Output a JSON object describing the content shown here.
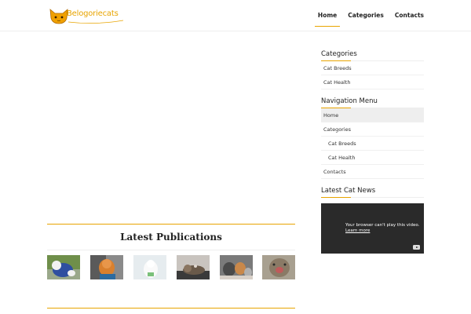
{
  "header": {
    "logo_text": "Belogoriecats",
    "nav": [
      {
        "label": "Home",
        "active": true
      },
      {
        "label": "Categories",
        "active": false
      },
      {
        "label": "Contacts",
        "active": false
      }
    ]
  },
  "publications": {
    "title": "Latest Publications",
    "thumbnails": [
      {
        "icon": "cat-blue-sweater-photo"
      },
      {
        "icon": "orange-kitten-photo"
      },
      {
        "icon": "white-cat-photo"
      },
      {
        "icon": "cat-lying-photo"
      },
      {
        "icon": "cats-group-photo"
      },
      {
        "icon": "cat-yawning-photo"
      }
    ]
  },
  "sidebar": {
    "categories_title": "Categories",
    "categories": [
      "Cat Breeds",
      "Cat Health"
    ],
    "nav_menu_title": "Navigation Menu",
    "nav_menu": [
      {
        "label": "Home",
        "sub": false,
        "active": true
      },
      {
        "label": "Categories",
        "sub": false,
        "active": false
      },
      {
        "label": "Cat Breeds",
        "sub": true,
        "active": false
      },
      {
        "label": "Cat Health",
        "sub": true,
        "active": false
      },
      {
        "label": "Contacts",
        "sub": false,
        "active": false
      }
    ],
    "news_title": "Latest Cat News",
    "video": {
      "message": "Your browser can't play this video.",
      "link": "Learn more",
      "icon": "youtube-icon"
    }
  },
  "colors": {
    "accent": "#e8a400",
    "video_bg": "#2a2a2a"
  }
}
